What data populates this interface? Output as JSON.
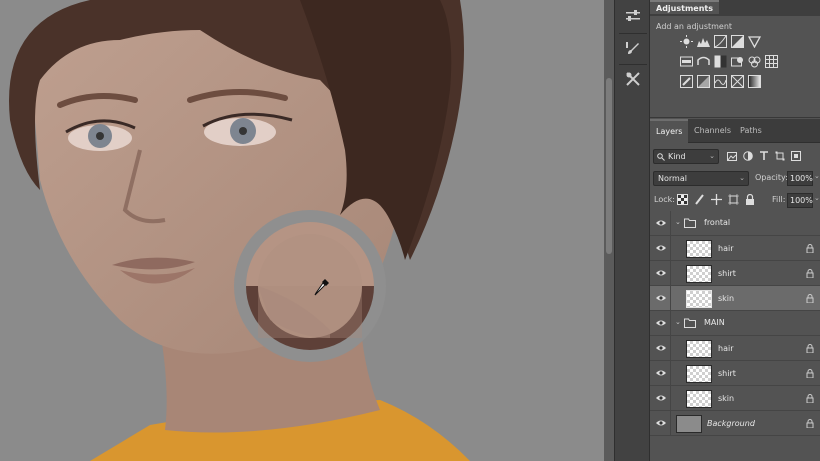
{
  "adjustments": {
    "tab_label": "Adjustments",
    "subtitle": "Add an adjustment",
    "rows": [
      [
        "brightness-contrast-icon",
        "levels-icon",
        "curves-icon",
        "exposure-icon",
        "vibrance-icon"
      ],
      [
        "hue-saturation-icon",
        "color-balance-icon",
        "black-white-icon",
        "photo-filter-icon",
        "channel-mixer-icon",
        "color-lookup-icon"
      ],
      [
        "invert-icon",
        "posterize-icon",
        "threshold-icon",
        "selective-color-icon",
        "gradient-map-icon"
      ]
    ]
  },
  "layers_panel": {
    "tabs": [
      {
        "label": "Layers",
        "active": true
      },
      {
        "label": "Channels",
        "active": false
      },
      {
        "label": "Paths",
        "active": false
      }
    ],
    "filter_kind": "Kind",
    "blend_mode": "Normal",
    "opacity_label": "Opacity:",
    "opacity_value": "100%",
    "lock_label": "Lock:",
    "fill_label": "Fill:",
    "fill_value": "100%",
    "layers": [
      {
        "type": "group",
        "name": "frontal"
      },
      {
        "type": "layer",
        "name": "hair",
        "selected": false
      },
      {
        "type": "layer",
        "name": "shirt",
        "selected": false
      },
      {
        "type": "layer",
        "name": "skin",
        "selected": true
      },
      {
        "type": "group",
        "name": "MAIN"
      },
      {
        "type": "layer",
        "name": "hair",
        "selected": false
      },
      {
        "type": "layer",
        "name": "shirt",
        "selected": false
      },
      {
        "type": "layer",
        "name": "skin",
        "selected": false
      },
      {
        "type": "background",
        "name": "Background"
      }
    ]
  },
  "colors": {
    "canvas_bg": "#8b8b8b",
    "hair": "#4a3229",
    "skin": "#b59484",
    "sampled_color": "#5e4038",
    "shirt": "#d9962f",
    "panel_bg": "#535353"
  }
}
